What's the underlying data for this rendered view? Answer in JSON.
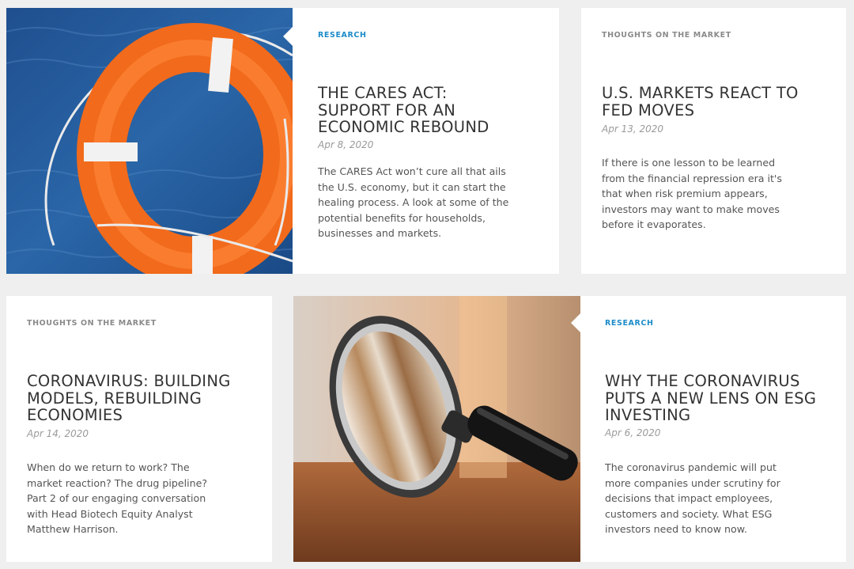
{
  "articles": [
    {
      "category": "RESEARCH",
      "title": "THE CARES ACT: SUPPORT FOR AN ECONOMIC REBOUND",
      "date": "Apr 8, 2020",
      "description": "The CARES Act won’t cure all that ails the U.S. economy, but it can start the healing process. A look at some of the potential benefits for households, businesses and markets.",
      "image": "life-ring-in-water"
    },
    {
      "category": "THOUGHTS ON THE MARKET",
      "title": "U.S. MARKETS REACT TO FED MOVES",
      "date": "Apr 13, 2020",
      "description": "If there is one lesson to be learned from the financial repression era it's that when risk premium appears, investors may want to make moves before it evaporates."
    },
    {
      "category": "THOUGHTS ON THE MARKET",
      "title": "CORONAVIRUS: BUILDING MODELS, REBUILDING ECONOMIES",
      "date": "Apr 14, 2020",
      "description": "When do we return to work? The market reaction? The drug pipeline? Part 2 of our engaging conversation with Head Biotech Equity Analyst Matthew Harrison."
    },
    {
      "category": "RESEARCH",
      "title": "WHY THE CORONAVIRUS PUTS A NEW LENS ON ESG INVESTING",
      "date": "Apr 6, 2020",
      "description": "The coronavirus pandemic will put more companies under scrutiny for decisions that impact employees, customers and society. What ESG investors need to know now.",
      "image": "magnifying-glass"
    }
  ],
  "colors": {
    "research": "#1d8cc9",
    "thoughts": "#8a8a8a",
    "background": "#efefef"
  }
}
